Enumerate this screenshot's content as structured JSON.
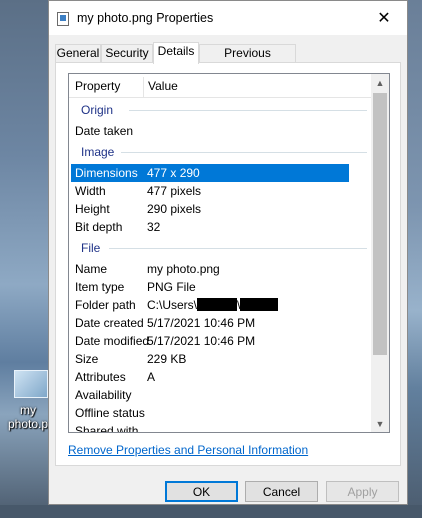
{
  "desktop": {
    "icon_label_line1": "my",
    "icon_label_line2": "photo.p"
  },
  "window": {
    "title": "my photo.png Properties",
    "close_glyph": "✕"
  },
  "tabs": [
    {
      "label": "General",
      "active": false
    },
    {
      "label": "Security",
      "active": false
    },
    {
      "label": "Details",
      "active": true
    },
    {
      "label": "Previous Versions",
      "active": false
    }
  ],
  "list": {
    "header": {
      "property": "Property",
      "value": "Value"
    },
    "sections": {
      "origin": "Origin",
      "image": "Image",
      "file": "File"
    },
    "origin_rows": [
      {
        "name": "Date taken",
        "value": ""
      }
    ],
    "image_rows": [
      {
        "name": "Dimensions",
        "value": "477 x 290"
      },
      {
        "name": "Width",
        "value": "477 pixels"
      },
      {
        "name": "Height",
        "value": "290 pixels"
      },
      {
        "name": "Bit depth",
        "value": "32"
      }
    ],
    "file_rows": [
      {
        "name": "Name",
        "value": "my photo.png"
      },
      {
        "name": "Item type",
        "value": "PNG File"
      },
      {
        "name": "Folder path",
        "value": "C:\\Users\\"
      },
      {
        "name": "Date created",
        "value": "5/17/2021 10:46 PM"
      },
      {
        "name": "Date modified",
        "value": "5/17/2021 10:46 PM"
      },
      {
        "name": "Size",
        "value": "229 KB"
      },
      {
        "name": "Attributes",
        "value": "A"
      },
      {
        "name": "Availability",
        "value": ""
      },
      {
        "name": "Offline status",
        "value": ""
      },
      {
        "name": "Shared with",
        "value": ""
      }
    ],
    "folder_path_separator": "\\"
  },
  "link": {
    "remove_properties": "Remove Properties and Personal Information"
  },
  "buttons": {
    "ok": "OK",
    "cancel": "Cancel",
    "apply": "Apply"
  },
  "scrollbar": {
    "up_glyph": "▲",
    "down_glyph": "▼"
  },
  "colors": {
    "selection": "#0078d7",
    "section_label": "#1e3287",
    "link": "#0066cc"
  }
}
